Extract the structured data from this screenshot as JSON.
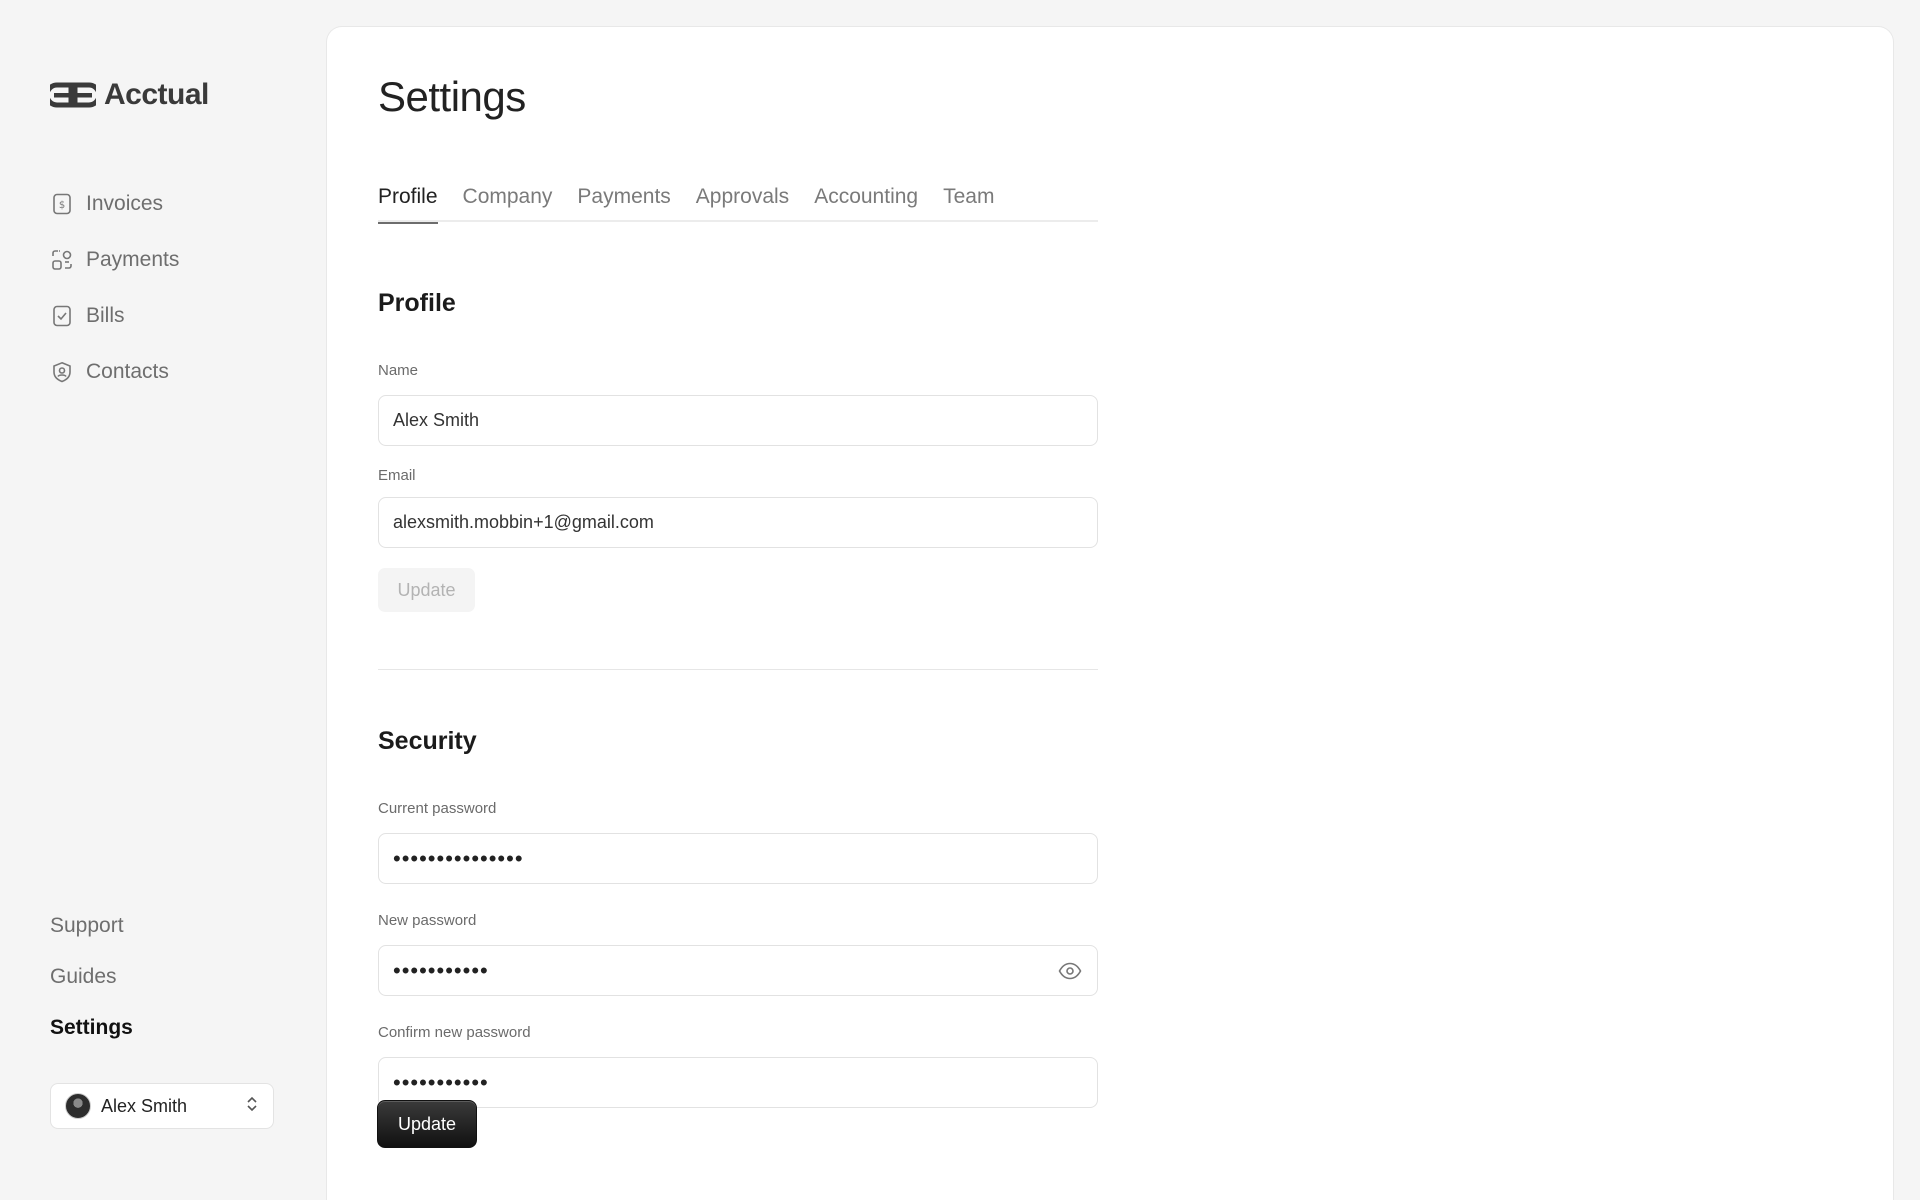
{
  "brand": {
    "name": "Acctual",
    "icon": "acctual-logo"
  },
  "sidebar": {
    "items": [
      {
        "label": "Invoices",
        "icon": "invoice-dollar-icon"
      },
      {
        "label": "Payments",
        "icon": "payments-grid-icon"
      },
      {
        "label": "Bills",
        "icon": "bill-check-icon"
      },
      {
        "label": "Contacts",
        "icon": "contact-shield-icon"
      }
    ],
    "bottom": [
      {
        "label": "Support"
      },
      {
        "label": "Guides"
      },
      {
        "label": "Settings",
        "active": true
      }
    ],
    "user": {
      "name": "Alex Smith"
    }
  },
  "page": {
    "title": "Settings",
    "tabs": [
      {
        "label": "Profile",
        "active": true
      },
      {
        "label": "Company"
      },
      {
        "label": "Payments"
      },
      {
        "label": "Approvals"
      },
      {
        "label": "Accounting"
      },
      {
        "label": "Team"
      }
    ]
  },
  "profile": {
    "title": "Profile",
    "name_label": "Name",
    "name_value": "Alex Smith",
    "email_label": "Email",
    "email_value": "alexsmith.mobbin+1@gmail.com",
    "update_label": "Update"
  },
  "security": {
    "title": "Security",
    "current_label": "Current password",
    "current_value": "•••••••••••••••",
    "new_label": "New password",
    "new_value": "•••••••••••",
    "confirm_label": "Confirm new password",
    "confirm_value": "•••••••••••",
    "update_label": "Update"
  }
}
